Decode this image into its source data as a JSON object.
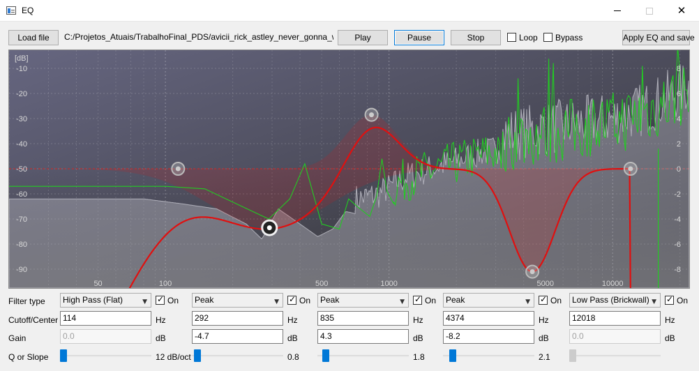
{
  "window": {
    "title": "EQ",
    "minimize": "minimize",
    "maximize": "maximize",
    "close": "✕"
  },
  "toolbar": {
    "load_label": "Load file",
    "file_path": "C:/Projetos_Atuais/TrabalhoFinal_PDS/avicii_rick_astley_never_gonna_wake_you_up.wav",
    "play_label": "Play",
    "pause_label": "Pause",
    "stop_label": "Stop",
    "loop_label": "Loop",
    "loop_checked": false,
    "bypass_label": "Bypass",
    "bypass_checked": false,
    "apply_label": "Apply EQ and save"
  },
  "plot": {
    "unit_label": "[dB]",
    "left_axis": [
      "-10",
      "-20",
      "-30",
      "-40",
      "-50",
      "-60",
      "-70",
      "-80",
      "-90"
    ],
    "right_axis": [
      "8",
      "6",
      "4",
      "2",
      "0",
      "-2",
      "-4",
      "-6",
      "-8"
    ],
    "freq_labels": [
      "50",
      "100",
      "500",
      "1000",
      "5000",
      "10000"
    ],
    "colors": {
      "eq_curve": "#e01010",
      "spectrum_green": "#22cc22",
      "spectrum_gray": "#b8b8c0",
      "zero_line": "#c03030"
    }
  },
  "labels": {
    "filter_type": "Filter type",
    "cutoff": "Cutoff/Center",
    "gain": "Gain",
    "q": "Q or Slope"
  },
  "bands": [
    {
      "type": "High Pass (Flat)",
      "on_label": "On",
      "on": true,
      "freq": "114",
      "freq_unit": "Hz",
      "gain": "0.0",
      "gain_enabled": false,
      "gain_unit": "dB",
      "q_label": "12 dB/oct",
      "q_enabled": true
    },
    {
      "type": "Peak",
      "on_label": "On",
      "on": true,
      "freq": "292",
      "freq_unit": "Hz",
      "gain": "-4.7",
      "gain_enabled": true,
      "gain_unit": "dB",
      "q_label": "0.8",
      "q_enabled": true
    },
    {
      "type": "Peak",
      "on_label": "On",
      "on": true,
      "freq": "835",
      "freq_unit": "Hz",
      "gain": "4.3",
      "gain_enabled": true,
      "gain_unit": "dB",
      "q_label": "1.8",
      "q_enabled": true
    },
    {
      "type": "Peak",
      "on_label": "On",
      "on": true,
      "freq": "4374",
      "freq_unit": "Hz",
      "gain": "-8.2",
      "gain_enabled": true,
      "gain_unit": "dB",
      "q_label": "2.1",
      "q_enabled": true
    },
    {
      "type": "Low Pass (Brickwall)",
      "on_label": "On",
      "on": true,
      "freq": "12018",
      "freq_unit": "Hz",
      "gain": "0.0",
      "gain_enabled": false,
      "gain_unit": "dB",
      "q_label": "",
      "q_enabled": false
    }
  ]
}
